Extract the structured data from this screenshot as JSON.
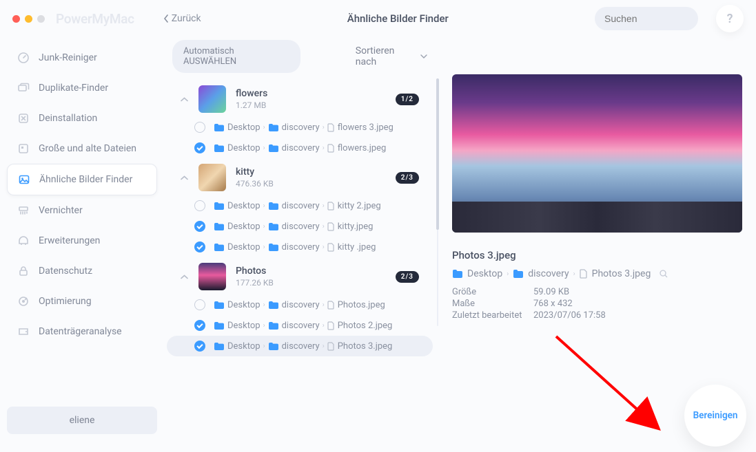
{
  "app_name": "PowerMyMac",
  "back_label": "Zurück",
  "page_title": "Ähnliche Bilder Finder",
  "search_placeholder": "Suchen",
  "help_label": "?",
  "sidebar": {
    "items": [
      {
        "label": "Junk-Reiniger"
      },
      {
        "label": "Duplikate-Finder"
      },
      {
        "label": "Deinstallation"
      },
      {
        "label": "Große und alte Dateien"
      },
      {
        "label": "Ähnliche Bilder Finder"
      },
      {
        "label": "Vernichter"
      },
      {
        "label": "Erweiterungen"
      },
      {
        "label": "Datenschutz"
      },
      {
        "label": "Optimierung"
      },
      {
        "label": "Datenträgeranalyse"
      }
    ],
    "user": "eliene"
  },
  "toolbar": {
    "auto_select": "Automatisch AUSWÄHLEN",
    "sort": "Sortieren nach"
  },
  "groups": [
    {
      "name": "flowers",
      "size": "1.27 MB",
      "badge": "1/2",
      "thumb": "flowers",
      "rows": [
        {
          "checked": false,
          "path": [
            "Desktop",
            "discovery"
          ],
          "file": "flowers 3.jpeg"
        },
        {
          "checked": true,
          "path": [
            "Desktop",
            "discovery"
          ],
          "file": "flowers.jpeg"
        }
      ]
    },
    {
      "name": "kitty",
      "size": "476.36 KB",
      "badge": "2/3",
      "thumb": "kitty",
      "rows": [
        {
          "checked": false,
          "path": [
            "Desktop",
            "discovery"
          ],
          "file": "kitty 2.jpeg"
        },
        {
          "checked": true,
          "path": [
            "Desktop",
            "discovery"
          ],
          "file": "kitty.jpeg"
        },
        {
          "checked": true,
          "path": [
            "Desktop",
            "discovery"
          ],
          "file": "kitty .jpeg"
        }
      ]
    },
    {
      "name": "Photos",
      "size": "177.26 KB",
      "badge": "2/3",
      "thumb": "photos",
      "rows": [
        {
          "checked": false,
          "path": [
            "Desktop",
            "discovery"
          ],
          "file": "Photos.jpeg"
        },
        {
          "checked": true,
          "path": [
            "Desktop",
            "discovery"
          ],
          "file": "Photos 2.jpeg"
        },
        {
          "checked": true,
          "selected": true,
          "path": [
            "Desktop",
            "discovery"
          ],
          "file": "Photos 3.jpeg"
        }
      ]
    }
  ],
  "preview": {
    "filename": "Photos 3.jpeg",
    "path": [
      "Desktop",
      "discovery",
      "Photos 3.jpeg"
    ],
    "meta": [
      {
        "k": "Größe",
        "v": "59.09 KB"
      },
      {
        "k": "Maße",
        "v": "768 x 432"
      },
      {
        "k": "Zuletzt bearbeitet",
        "v": "2023/07/06 17:58"
      }
    ]
  },
  "clean_label": "Bereinigen",
  "colors": {
    "accent": "#3b9bff"
  }
}
